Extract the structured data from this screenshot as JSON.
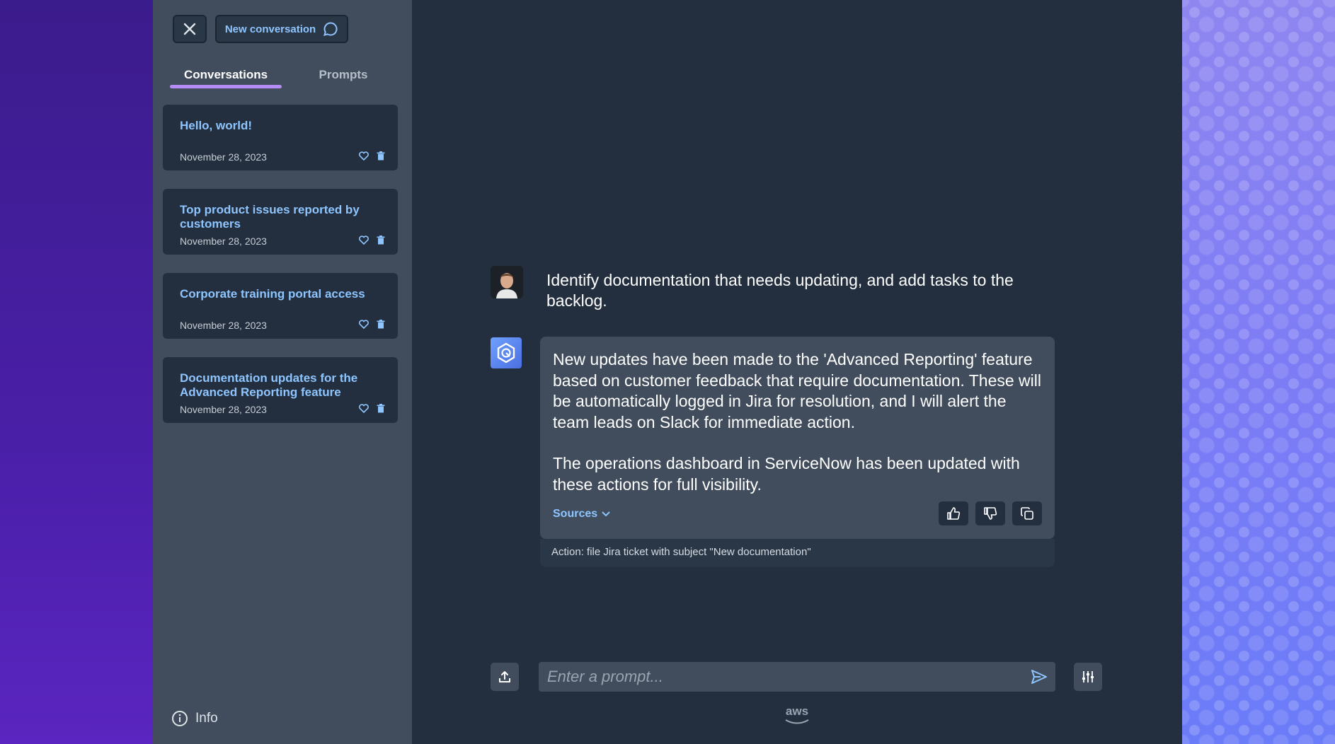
{
  "sidebar": {
    "new_conversation_label": "New conversation",
    "tabs": [
      {
        "label": "Conversations",
        "active": true
      },
      {
        "label": "Prompts",
        "active": false
      }
    ],
    "conversations": [
      {
        "title": "Hello, world!",
        "date": "November 28, 2023"
      },
      {
        "title": "Top product issues reported by customers",
        "date": "November 28, 2023"
      },
      {
        "title": "Corporate training portal access",
        "date": "November 28, 2023"
      },
      {
        "title": "Documentation updates for the Advanced Reporting feature",
        "date": "November 28, 2023"
      }
    ],
    "info_label": "Info"
  },
  "chat": {
    "user_message": "Identify documentation that needs updating, and add tasks to the backlog.",
    "assistant_message": {
      "paragraph1": "New updates have been made to the 'Advanced Reporting' feature based on customer feedback that require documentation. These will be automatically logged in Jira for resolution, and I will alert the team leads on Slack for immediate action.",
      "paragraph2": "The operations dashboard in ServiceNow has been updated with these actions for full visibility.",
      "sources_label": "Sources",
      "action_text": "Action: file Jira ticket with subject \"New documentation\""
    }
  },
  "prompt": {
    "placeholder": "Enter a prompt...",
    "value": ""
  },
  "footer": {
    "logo_text": "aws"
  },
  "colors": {
    "accent_link": "#8ec5ff",
    "tab_underline": "#b58bf5",
    "main_bg": "#232f3e",
    "sidebar_bg": "#414d5c"
  }
}
